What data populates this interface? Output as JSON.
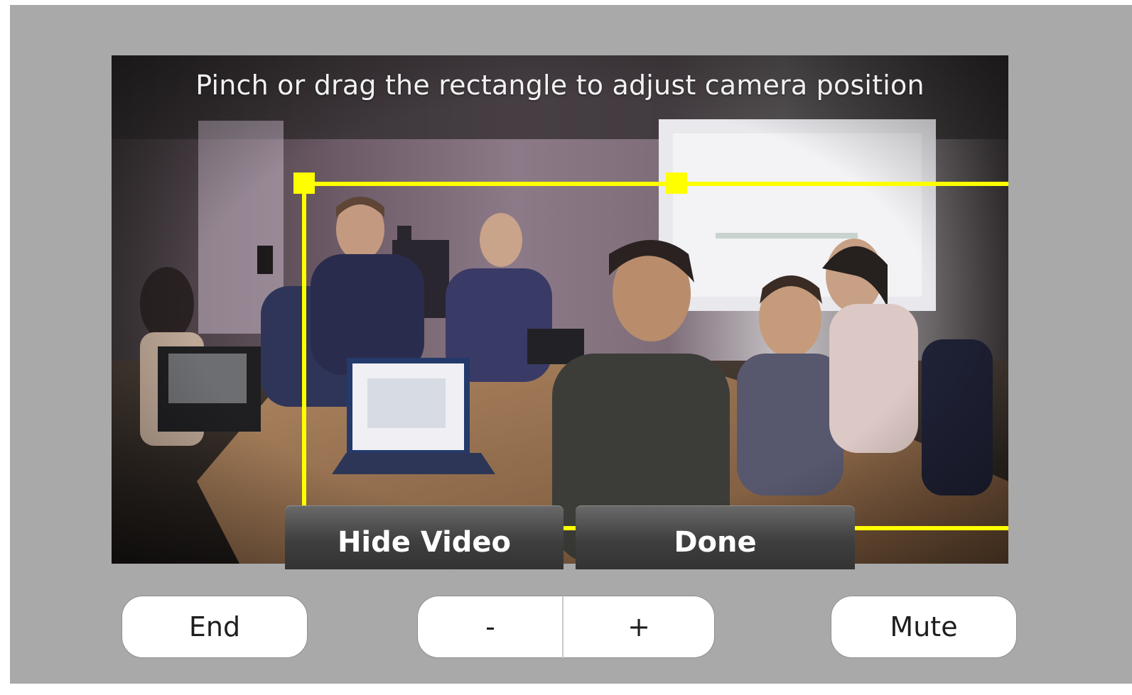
{
  "camera_view": {
    "instruction": "Pinch or drag the rectangle to adjust camera position",
    "highlight_color": "#ffff00"
  },
  "overlay_buttons": {
    "hide_video": "Hide Video",
    "done": "Done"
  },
  "controls": {
    "end": "End",
    "zoom_out": "-",
    "zoom_in": "+",
    "mute": "Mute"
  },
  "icons": {
    "crop_handles": "square-handle-icon"
  }
}
